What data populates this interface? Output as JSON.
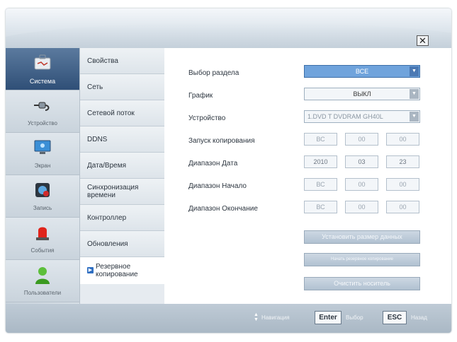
{
  "window": {
    "close_glyph": "✕"
  },
  "icon_nav": [
    {
      "label": "Система",
      "icon": "system-icon",
      "active": true
    },
    {
      "label": "Устройство",
      "icon": "device-icon",
      "active": false
    },
    {
      "label": "Экран",
      "icon": "display-icon",
      "active": false
    },
    {
      "label": "Запись",
      "icon": "record-icon",
      "active": false
    },
    {
      "label": "События",
      "icon": "alarm-icon",
      "active": false
    },
    {
      "label": "Пользователи",
      "icon": "user-icon",
      "active": false
    }
  ],
  "tabs": [
    {
      "label": "Свойства"
    },
    {
      "label": "Сеть"
    },
    {
      "label": "Сетевой поток"
    },
    {
      "label": "DDNS"
    },
    {
      "label": "Дата/Время"
    },
    {
      "label": "Синхронизация времени"
    },
    {
      "label": "Контроллер"
    },
    {
      "label": "Обновления"
    },
    {
      "label": "Резервное копирование",
      "active": true
    }
  ],
  "form": {
    "section_label": "Выбор раздела",
    "section_value": "ВСЕ",
    "schedule_label": "График",
    "schedule_value": "ВЫКЛ",
    "device_label": "Устройство",
    "device_value": "1.DVD T DVDRAM GH40L",
    "start_copy_label": "Запуск копирования",
    "start_copy_values": [
      "ВС",
      "00",
      "00"
    ],
    "range_date_label": "Диапазон Дата",
    "range_date_values": [
      "2010",
      "03",
      "23"
    ],
    "range_start_label": "Диапазон Начало",
    "range_start_values": [
      "ВС",
      "00",
      "00"
    ],
    "range_end_label": "Диапазон Окончание",
    "range_end_values": [
      "ВС",
      "00",
      "00"
    ]
  },
  "actions": {
    "set_size": "Установить размер данных",
    "start_backup": "Начать резервное копирование",
    "clear_media": "Очистить носитель"
  },
  "footer": {
    "nav_hint": "Навигация",
    "enter_key": "Enter",
    "enter_hint": "Выбор",
    "esc_key": "ESC",
    "esc_hint": "Назад"
  },
  "colors": {
    "accent": "#6fa3dc",
    "active_nav": "#2f4f77",
    "alarm": "#e0241b"
  }
}
